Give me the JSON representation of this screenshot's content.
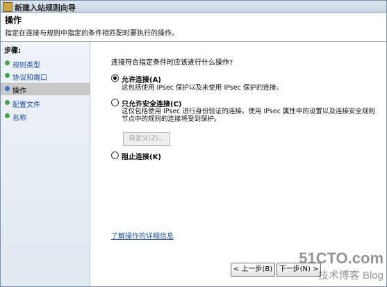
{
  "window": {
    "title": "新建入站规则向导"
  },
  "header": {
    "title": "操作",
    "description": "指定在连接与规则中指定的条件相匹配时要执行的操作。"
  },
  "steps": {
    "title": "步骤:",
    "items": [
      {
        "label": "规则类型",
        "state": "done"
      },
      {
        "label": "协议和端口",
        "state": "done"
      },
      {
        "label": "操作",
        "state": "active"
      },
      {
        "label": "配置文件",
        "state": "pending"
      },
      {
        "label": "名称",
        "state": "pending"
      }
    ]
  },
  "main": {
    "question": "连接符合指定条件时应该进行什么操作?",
    "options": [
      {
        "label": "允许连接(A)",
        "desc": "这包括使用 IPsec 保护以及未使用 IPsec 保护的连接。",
        "checked": true
      },
      {
        "label": "只允许安全连接(C)",
        "desc": "这仅包括使用 IPsec 进行身份验证的连接。使用 IPsec 属性中的设置以及连接安全规则节点中的规则的连接将受到保护。",
        "checked": false
      },
      {
        "label": "阻止连接(K)",
        "desc": "",
        "checked": false
      }
    ],
    "custom_button": "自定义(Z)...",
    "learn_more": "了解操作的详细信息"
  },
  "buttons": {
    "back": "< 上一步(B)",
    "next": "下一步(N) >"
  },
  "watermark": {
    "line1": "51CTO.com",
    "line2": "技术博客 Blog"
  }
}
